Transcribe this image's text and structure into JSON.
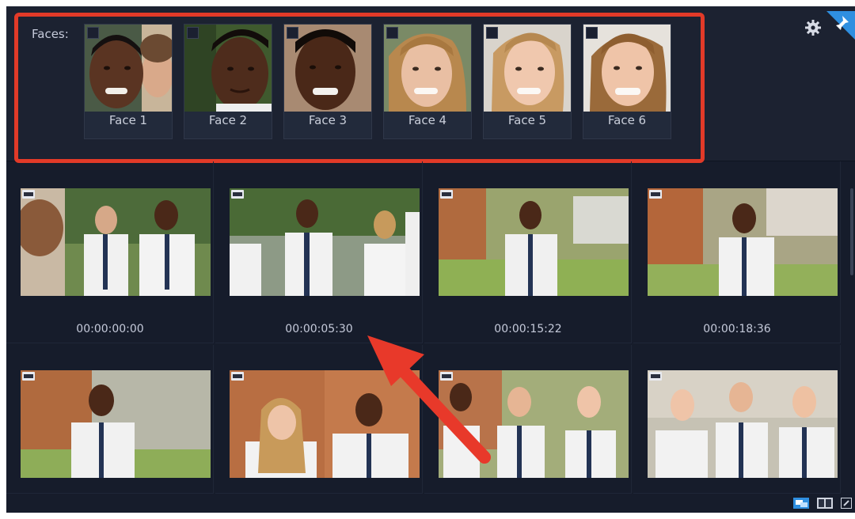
{
  "faces": {
    "label": "Faces:",
    "items": [
      {
        "name": "Face 1"
      },
      {
        "name": "Face 2"
      },
      {
        "name": "Face 3"
      },
      {
        "name": "Face 4"
      },
      {
        "name": "Face 5"
      },
      {
        "name": "Face 6"
      }
    ]
  },
  "toolbar": {
    "settings_icon": "gear-icon",
    "pin_icon": "pin-icon"
  },
  "clips": [
    {
      "timecode": "00:00:00:00"
    },
    {
      "timecode": "00:00:05:30"
    },
    {
      "timecode": "00:00:15:22"
    },
    {
      "timecode": "00:00:18:36"
    },
    {
      "timecode": ""
    },
    {
      "timecode": ""
    },
    {
      "timecode": ""
    },
    {
      "timecode": ""
    }
  ],
  "colors": {
    "panel_bg": "#161c2b",
    "highlight": "#e23a28",
    "accent": "#2f8fe0"
  }
}
